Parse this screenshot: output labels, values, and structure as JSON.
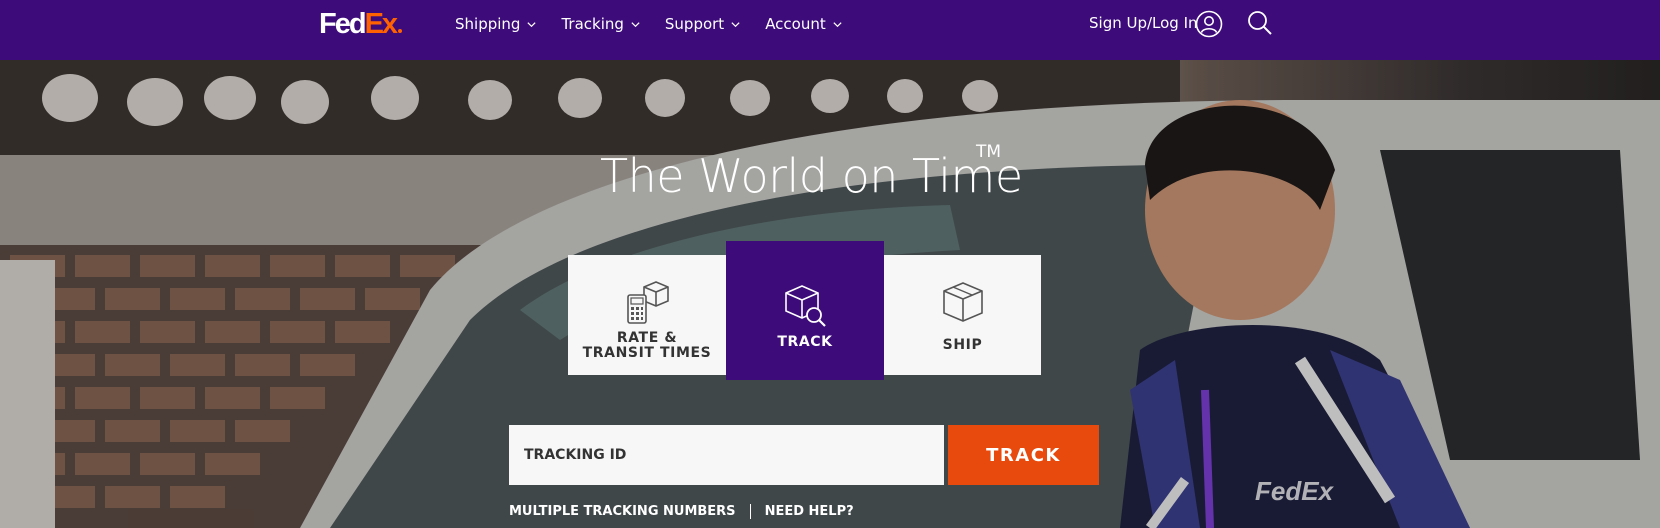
{
  "brand": {
    "name_fed": "Fed",
    "name_ex": "Ex",
    "purple": "#3d0c7a",
    "orange": "#ff6200"
  },
  "nav": {
    "menu": [
      {
        "label": "Shipping"
      },
      {
        "label": "Tracking"
      },
      {
        "label": "Support"
      },
      {
        "label": "Account"
      }
    ],
    "signin_label": "Sign Up/Log In",
    "icons": [
      "user-icon",
      "search-icon"
    ]
  },
  "hero": {
    "headline": "The World on Time",
    "trademark": "TM",
    "tiles": [
      {
        "label_line1": "RATE &",
        "label_line2": "TRANSIT TIMES",
        "icon": "calculator-box-icon"
      },
      {
        "label": "TRACK",
        "icon": "package-search-icon",
        "selected": true
      },
      {
        "label": "SHIP",
        "icon": "package-icon"
      }
    ]
  },
  "track_form": {
    "input_placeholder": "TRACKING ID",
    "button_label": "TRACK",
    "button_color": "#e8490c",
    "links": [
      "MULTIPLE TRACKING NUMBERS",
      "NEED HELP?"
    ]
  }
}
